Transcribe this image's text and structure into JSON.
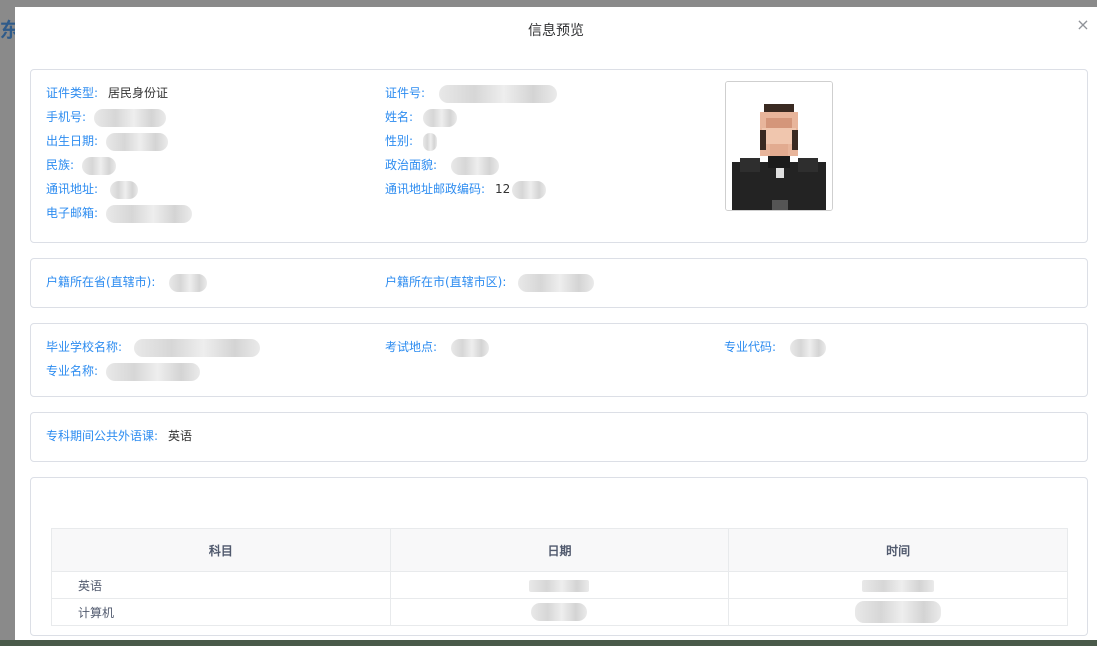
{
  "modal": {
    "title": "信息预览",
    "close_icon": "×"
  },
  "personal": {
    "id_type_label": "证件类型:",
    "id_type_value": "居民身份证",
    "id_number_label": "证件号:",
    "phone_label": "手机号:",
    "name_label": "姓名:",
    "birth_label": "出生日期:",
    "gender_label": "性别:",
    "ethnicity_label": "民族:",
    "political_label": "政治面貌:",
    "address_label": "通讯地址:",
    "postcode_label": "通讯地址邮政编码:",
    "postcode_value_prefix": "12",
    "email_label": "电子邮箱:"
  },
  "household": {
    "province_label": "户籍所在省(直辖市):",
    "city_label": "户籍所在市(直辖市区):"
  },
  "education": {
    "school_label": "毕业学校名称:",
    "exam_location_label": "考试地点:",
    "major_code_label": "专业代码:",
    "major_name_label": "专业名称:"
  },
  "language": {
    "label": "专科期间公共外语课:",
    "value": "英语"
  },
  "schedule": {
    "headers": [
      "科目",
      "日期",
      "时间"
    ],
    "rows": [
      {
        "subject": "英语"
      },
      {
        "subject": "计算机"
      }
    ]
  }
}
